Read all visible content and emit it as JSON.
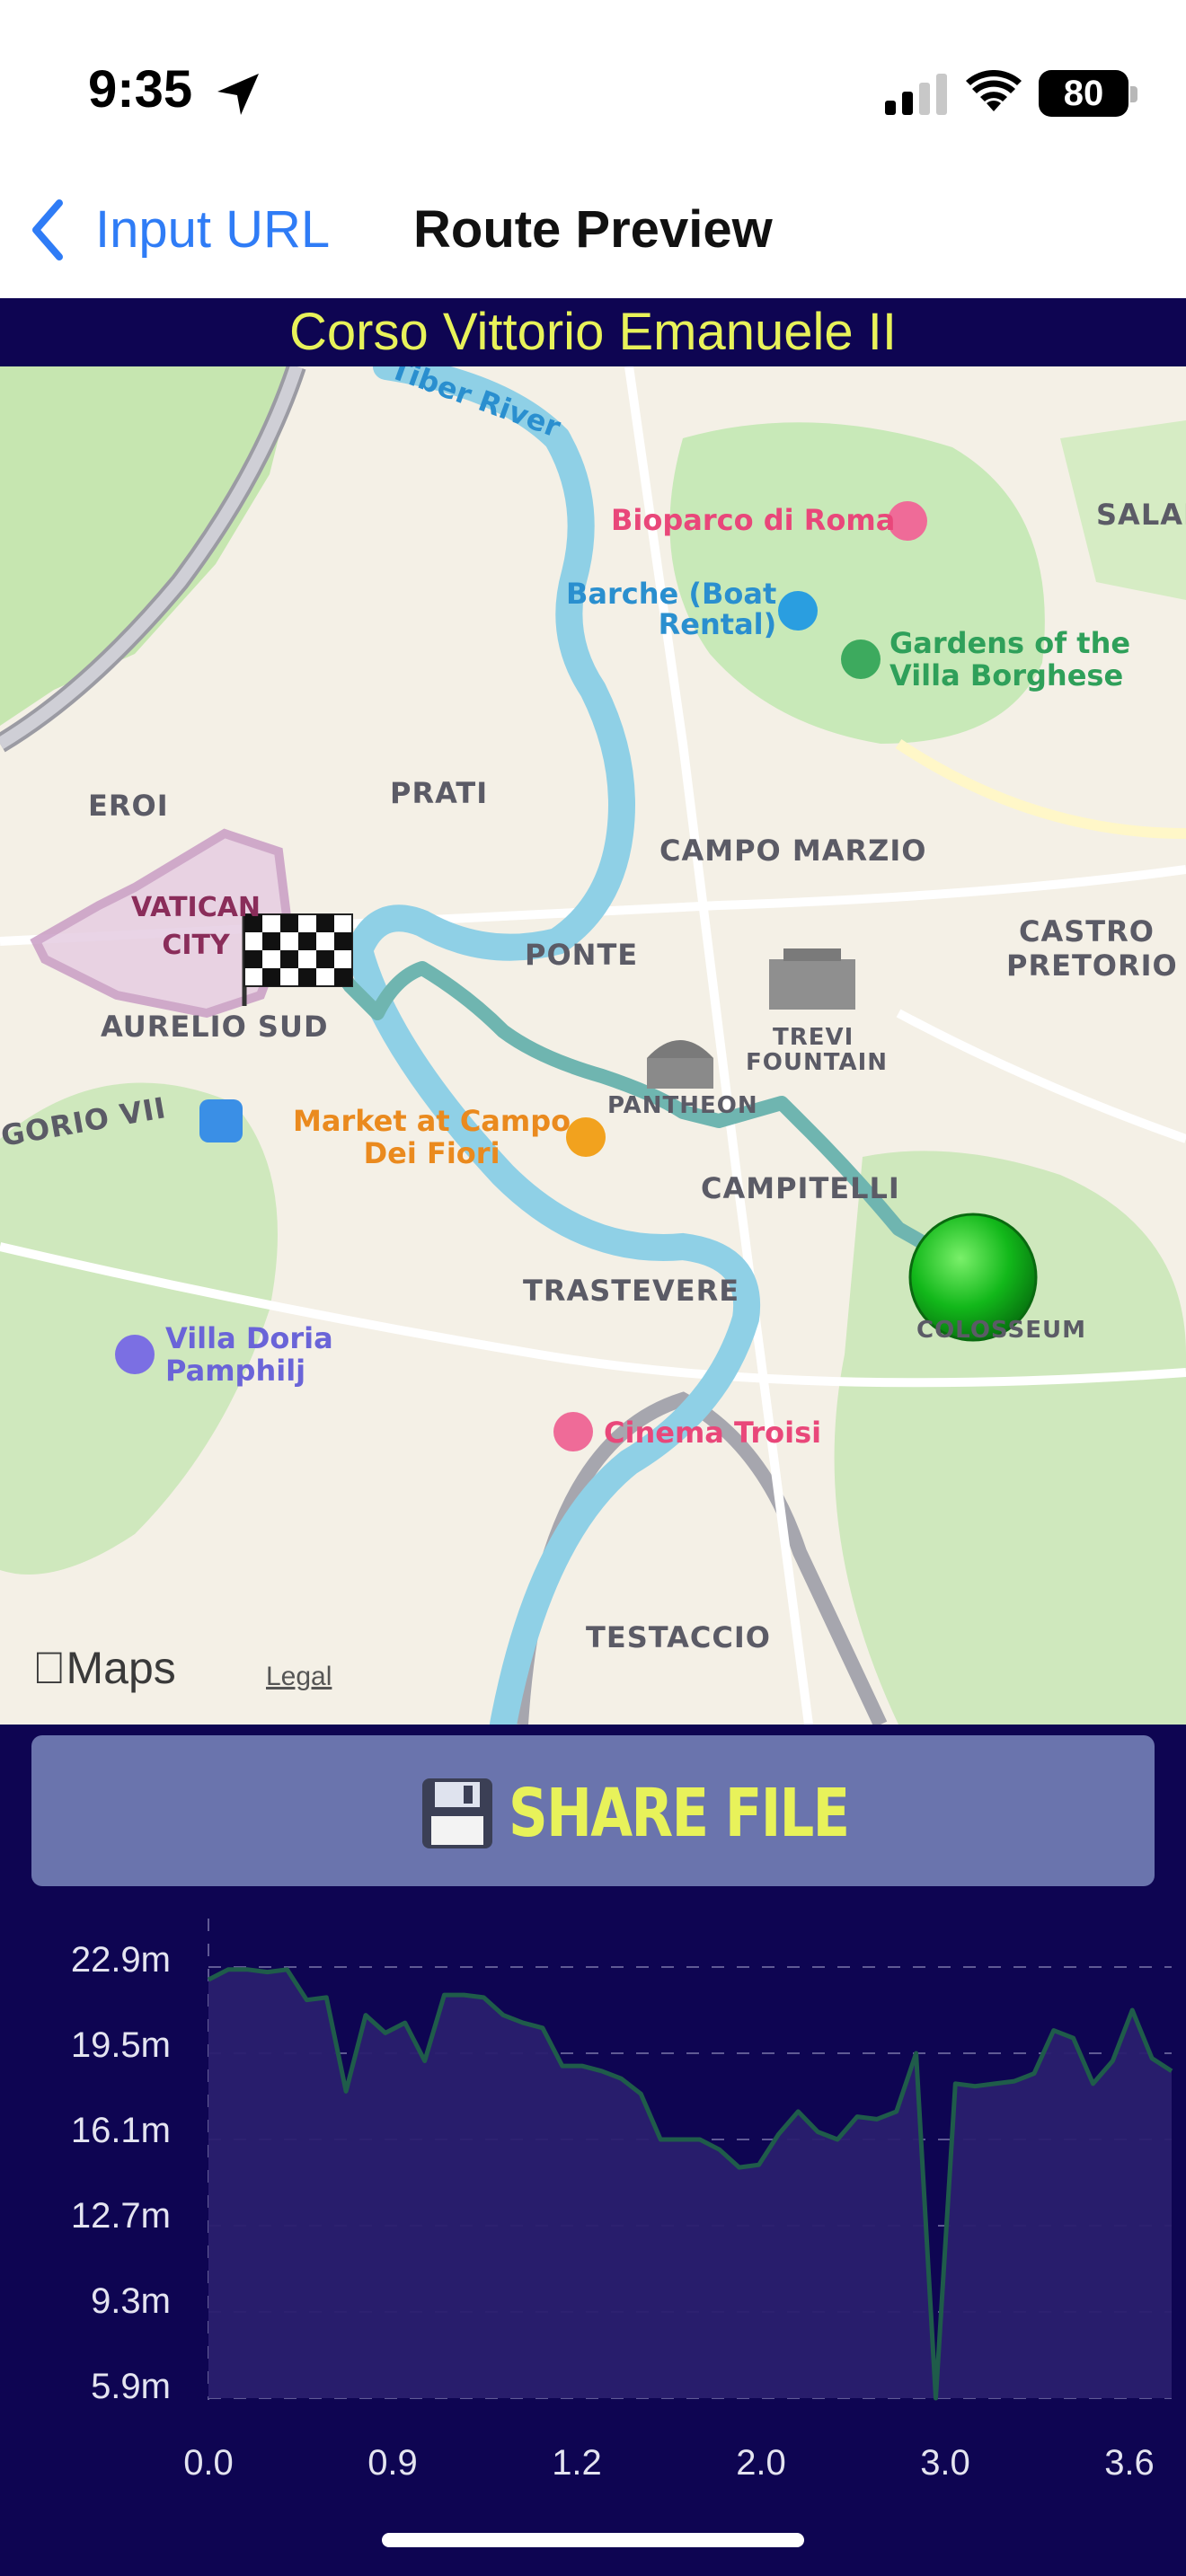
{
  "status_bar": {
    "time": "9:35",
    "location_icon": "location-arrow-icon",
    "signal_icon": "cellular-signal-icon",
    "wifi_icon": "wifi-icon",
    "battery_level": "80"
  },
  "nav": {
    "back_label": "Input URL",
    "back_icon": "chevron-left-icon",
    "title": "Route Preview"
  },
  "street_banner": "Corso Vittorio Emanuele II",
  "map": {
    "districts": [
      "PRATI",
      "CAMPO MARZIO",
      "PONTE",
      "CASTRO",
      "PRETORIO",
      "EROI",
      "AURELIO SUD",
      "CAMPITELLI",
      "TRASTEVERE",
      "TESTACCIO",
      "SALAR",
      "GORIO VII",
      "PANTHEON",
      "TREVI",
      "FOUNTAIN",
      "COLOSSEUM"
    ],
    "vatican": [
      "VATICAN",
      "CITY"
    ],
    "river": "Tiber River",
    "pois": {
      "bioparco": "Bioparco di Roma",
      "barche_line1": "Barche (Boat",
      "barche_line2": "Rental)",
      "gardens_line1": "Gardens of the",
      "gardens_line2": "Villa Borghese",
      "market_line1": "Market at Campo",
      "market_line2": "Dei Fiori",
      "villa_line1": "Villa Doria",
      "villa_line2": "Pamphilj",
      "cinema": "Cinema Troisi"
    },
    "attribution": "Maps",
    "legal": "Legal",
    "start_marker": "green-ball-marker",
    "finish_marker": "checkered-flag-icon",
    "route_color": "#6fb5b0"
  },
  "share_button": {
    "icon": "floppy-disk-icon",
    "label": "SHARE FILE"
  },
  "chart_data": {
    "type": "area",
    "title": "",
    "xlabel": "",
    "ylabel": "",
    "y_ticks": [
      "22.9m",
      "19.5m",
      "16.1m",
      "12.7m",
      "9.3m",
      "5.9m"
    ],
    "x_ticks": [
      "0.0",
      "0.9",
      "1.2",
      "2.0",
      "3.0",
      "3.6"
    ],
    "ylim": [
      5.9,
      22.9
    ],
    "grid": true,
    "line_color": "#1f5c4a",
    "fill_color": "#2a1f6e",
    "series": [
      {
        "values": [
          22.4,
          22.8,
          22.8,
          22.7,
          22.8,
          21.6,
          21.7,
          18.0,
          21.0,
          20.3,
          20.7,
          19.2,
          21.8,
          21.8,
          21.7,
          21.0,
          20.7,
          20.5,
          19.0,
          19.0,
          18.8,
          18.5,
          17.9,
          16.1,
          16.1,
          16.1,
          15.7,
          15.0,
          15.1,
          16.3,
          17.2,
          16.4,
          16.1,
          17.0,
          16.9,
          17.2,
          19.5,
          5.9,
          18.3,
          18.2,
          18.3,
          18.4,
          18.7,
          20.4,
          20.1,
          18.3,
          19.2,
          21.2,
          19.3,
          18.8
        ]
      }
    ]
  }
}
